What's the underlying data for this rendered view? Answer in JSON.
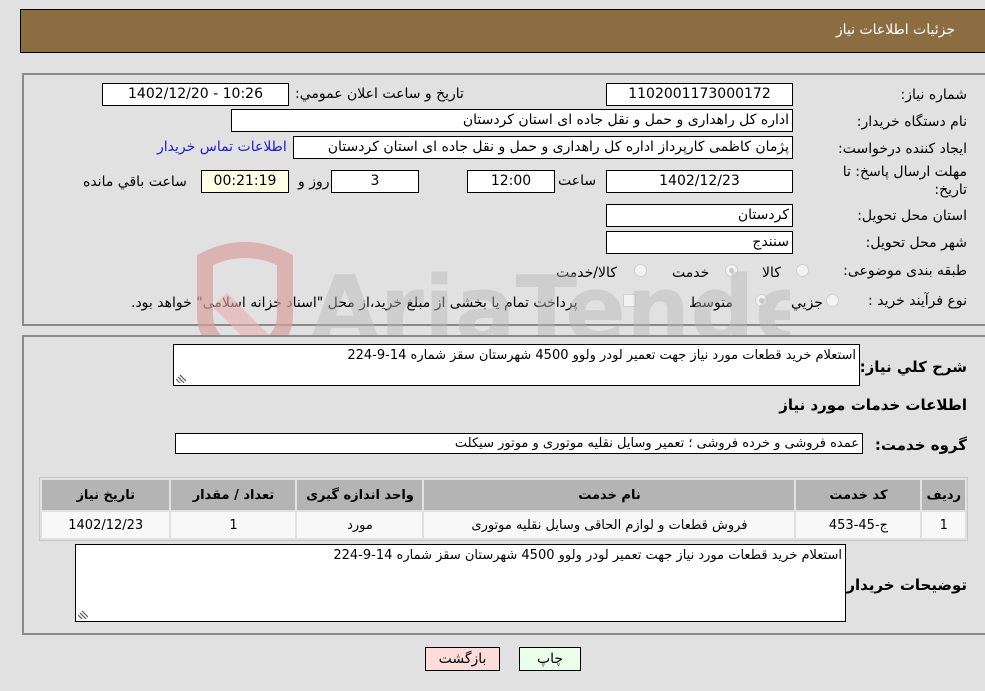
{
  "header": {
    "title": "جزئیات اطلاعات نیاز"
  },
  "form": {
    "need_number_label": "شماره نیاز:",
    "need_number": "1102001173000172",
    "announce_label": "تاريخ و ساعت اعلان عمومي:",
    "announce_value": "1402/12/20 - 10:26",
    "buyer_org_label": "نام دستگاه خریدار:",
    "buyer_org": "اداره کل راهداری و حمل و نقل جاده ای استان کردستان",
    "creator_label": "ایجاد کننده درخواست:",
    "creator": "پژمان کاظمی کارپرداز اداره کل راهداری و حمل و نقل جاده ای استان کردستان",
    "contact_link": "اطلاعات تماس خریدار",
    "deadline_label": "مهلت ارسال پاسخ: تا تاریخ:",
    "deadline_date": "1402/12/23",
    "time_label": "ساعت",
    "deadline_time": "12:00",
    "days_value": "3",
    "days_label": "روز و",
    "remaining_time": "00:21:19",
    "remaining_label": "ساعت باقي مانده",
    "province_label": "استان محل تحویل:",
    "province": "کردستان",
    "city_label": "شهر محل تحویل:",
    "city": "سنندج",
    "category_label": "طبقه بندی موضوعی:",
    "category_options": [
      {
        "label": "کالا",
        "selected": false
      },
      {
        "label": "خدمت",
        "selected": true
      },
      {
        "label": "کالا/خدمت",
        "selected": false
      }
    ],
    "process_label": "نوع فرآیند خرید :",
    "process_options": [
      {
        "label": "جزيي",
        "selected": false
      },
      {
        "label": "متوسط",
        "selected": true
      }
    ],
    "treasury_checkbox_label": "پرداخت تمام یا بخشی از مبلغ خرید،از محل \"اسناد خزانه اسلامی\" خواهد بود.",
    "treasury_checked": false
  },
  "details": {
    "summary_label": "شرح کلي نياز:",
    "summary": "استعلام خرید قطعات مورد نیاز جهت تعمیر لودر ولوو 4500 شهرستان سقز شماره 14-9-224",
    "services_heading": "اطلاعات خدمات مورد نیاز",
    "service_group_label": "گروه خدمت:",
    "service_group": "عمده فروشی و خرده فروشی ؛ تعمیر وسایل نقلیه موتوری و موتور سیکلت",
    "table": {
      "headers": [
        "رديف",
        "کد خدمت",
        "نام خدمت",
        "واحد اندازه گیری",
        "تعداد / مقدار",
        "تاریخ نیاز"
      ],
      "rows": [
        [
          "1",
          "ج-45-453",
          "فروش قطعات و لوازم الحاقی وسایل نقلیه موتوری",
          "مورد",
          "1",
          "1402/12/23"
        ]
      ]
    },
    "buyer_notes_label": "توضیحات خریدار:",
    "buyer_notes": "استعلام خرید قطعات مورد نیاز جهت تعمیر لودر ولوو 4500 شهرستان سقز شماره 14-9-224"
  },
  "buttons": {
    "print": "چاپ",
    "back": "بازگشت"
  },
  "watermark": {
    "text": "AriaTender.neT"
  },
  "colors": {
    "header_bg": "#8c6d42",
    "print_bg": "#eaffea",
    "back_bg": "#ffdcdc",
    "link": "#2020c8"
  }
}
